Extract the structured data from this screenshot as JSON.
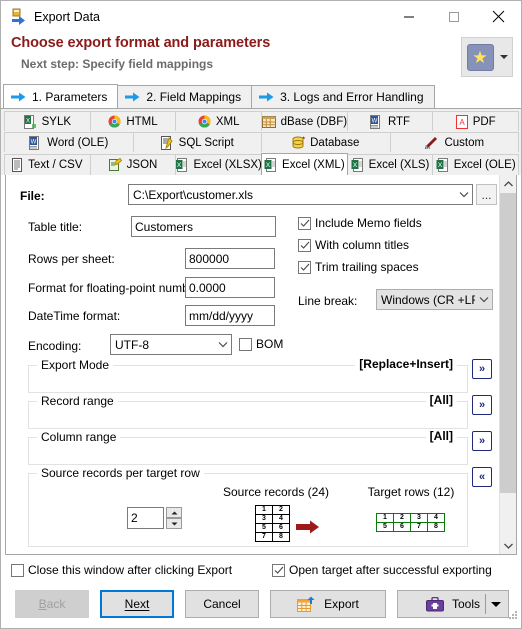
{
  "window": {
    "title": "Export Data",
    "icon": "export-data-icon",
    "minimize": "minimize-icon",
    "maximize": "maximize-icon",
    "close": "close-icon"
  },
  "header": {
    "title": "Choose export format and parameters",
    "subtitle": "Next step: Specify field mappings",
    "favorite_icon": "star-icon",
    "favorite_caret": "chevron-down-icon"
  },
  "wizard_tabs": [
    {
      "label": "1. Parameters",
      "active": true
    },
    {
      "label": "2. Field Mappings",
      "active": false
    },
    {
      "label": "3. Logs and Error Handling",
      "active": false
    }
  ],
  "format_tabs": {
    "row1": [
      {
        "label": "SYLK",
        "icon": "sylk-icon"
      },
      {
        "label": "HTML",
        "icon": "chrome-icon"
      },
      {
        "label": "XML",
        "icon": "chrome-icon"
      },
      {
        "label": "dBase (DBF)",
        "icon": "dbase-icon"
      },
      {
        "label": "RTF",
        "icon": "word-doc-icon"
      },
      {
        "label": "PDF",
        "icon": "pdf-icon"
      }
    ],
    "row2": [
      {
        "label": "Word (OLE)",
        "icon": "word-doc-icon"
      },
      {
        "label": "SQL Script",
        "icon": "sql-script-icon"
      },
      {
        "label": "Database",
        "icon": "database-icon"
      },
      {
        "label": "Custom",
        "icon": "pencil-icon"
      }
    ],
    "row3": [
      {
        "label": "Text / CSV",
        "icon": "text-file-icon",
        "active": false
      },
      {
        "label": "JSON",
        "icon": "json-icon",
        "active": false
      },
      {
        "label": "Excel (XLSX)",
        "icon": "excel-icon",
        "active": false
      },
      {
        "label": "Excel (XML)",
        "icon": "excel-icon",
        "active": true
      },
      {
        "label": "Excel (XLS)",
        "icon": "excel-icon",
        "active": false
      },
      {
        "label": "Excel (OLE)",
        "icon": "excel-icon",
        "active": false
      }
    ]
  },
  "form": {
    "file_label": "File:",
    "file_value": "C:\\Export\\customer.xls",
    "file_browse": "...",
    "table_title_label": "Table title:",
    "table_title_value": "Customers",
    "rows_per_sheet_label": "Rows per sheet:",
    "rows_per_sheet_value": "800000",
    "float_format_label": "Format for floating-point numbers",
    "float_format_value": "0.0000",
    "datetime_format_label": "DateTime format:",
    "datetime_format_value": "mm/dd/yyyy",
    "encoding_label": "Encoding:",
    "encoding_value": "UTF-8",
    "bom_label": "BOM",
    "bom_checked": false,
    "checkboxes": [
      {
        "label": "Include Memo fields",
        "checked": true
      },
      {
        "label": "With column titles",
        "checked": true
      },
      {
        "label": "Trim trailing spaces",
        "checked": true
      }
    ],
    "line_break_label": "Line break:",
    "line_break_value": "Windows (CR +LF)"
  },
  "groups": {
    "export_mode": {
      "caption": "Export Mode",
      "value": "[Replace+Insert]",
      "button": "expand-button"
    },
    "record_range": {
      "caption": "Record range",
      "value": "[All]",
      "button": "expand-button"
    },
    "column_range": {
      "caption": "Column range",
      "value": "[All]",
      "button": "expand-button"
    },
    "source_records": {
      "caption": "Source records per target row",
      "spinner_value": "2",
      "source_label": "Source records (24)",
      "target_label": "Target rows (12)",
      "arrow_icon": "right-arrow-icon",
      "collapse_button": "collapse-button",
      "source_grid": [
        [
          "1",
          "2"
        ],
        [
          "3",
          "4"
        ],
        [
          "5",
          "6"
        ],
        [
          "7",
          "8"
        ]
      ],
      "target_grid": [
        [
          "1",
          "2",
          "3",
          "4"
        ],
        [
          "5",
          "6",
          "7",
          "8"
        ]
      ]
    }
  },
  "bottom": {
    "close_window_label": "Close this window after clicking Export",
    "close_window_checked": false,
    "open_target_label": "Open target after successful exporting",
    "open_target_checked": true,
    "buttons": {
      "back": "Back",
      "next": "Next",
      "cancel": "Cancel",
      "export": "Export",
      "tools": "Tools"
    }
  },
  "colors": {
    "header_title": "#8b1a1a",
    "header_subtitle": "#6b6b6b",
    "default_button_border": "#0078d7",
    "group_value": "#000000",
    "chevron_button": "#20297a"
  }
}
